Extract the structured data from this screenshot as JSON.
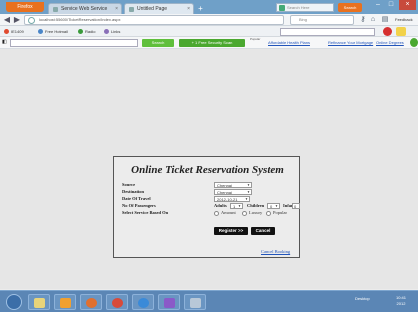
{
  "browser": {
    "firefox_label": "Firefox",
    "tabs": [
      {
        "label": "Service Web Service"
      },
      {
        "label": "Untitled Page"
      }
    ],
    "new_tab_label": "+",
    "title_search_placeholder": "Search Here",
    "title_orange_label": "Search",
    "url": "localhost:55600/TicketReservation/Index.aspx",
    "web_search_placeholder": "Bing",
    "feedback_label": "Feedback"
  },
  "bookmarks": [
    {
      "label": "IE1409",
      "color": "#e04b2f"
    },
    {
      "label": "Free Hotmail",
      "color": "#4a86c8"
    },
    {
      "label": "Radio",
      "color": "#3a9a3a"
    },
    {
      "label": "Links",
      "color": "#8a6fb8"
    }
  ],
  "toolbar2": {
    "search_button": "Search",
    "green_bar_label": "+ 1 Free Security Scan",
    "more_label": "Popular",
    "links": [
      "Affordable Health Plans",
      "Refinance Your Mortgage",
      "Online Degrees"
    ]
  },
  "form": {
    "title": "Online Ticket Reservation System",
    "labels": {
      "source": "Source",
      "destination": "Destination",
      "date": "Date Of Travel",
      "passengers": "No Of Passengers",
      "service": "Select Service Based On"
    },
    "source_value": "Chennai",
    "destination_value": "Chennai",
    "date_value": "2012-10-21",
    "adults_label": "Adults",
    "adults_value": "1",
    "children_label": "Children",
    "children_value": "0",
    "infants_label": "Infants",
    "infants_value": "0",
    "service_options": [
      "Amount",
      "Luxury",
      "Popular"
    ],
    "register_button": "Register >>",
    "cancel_button": "Cancel",
    "cancel_booking_link": "Cancel Booking"
  },
  "taskbar": {
    "clock_time": "10:41",
    "clock_date": "2012",
    "tray_label": "Desktop"
  }
}
